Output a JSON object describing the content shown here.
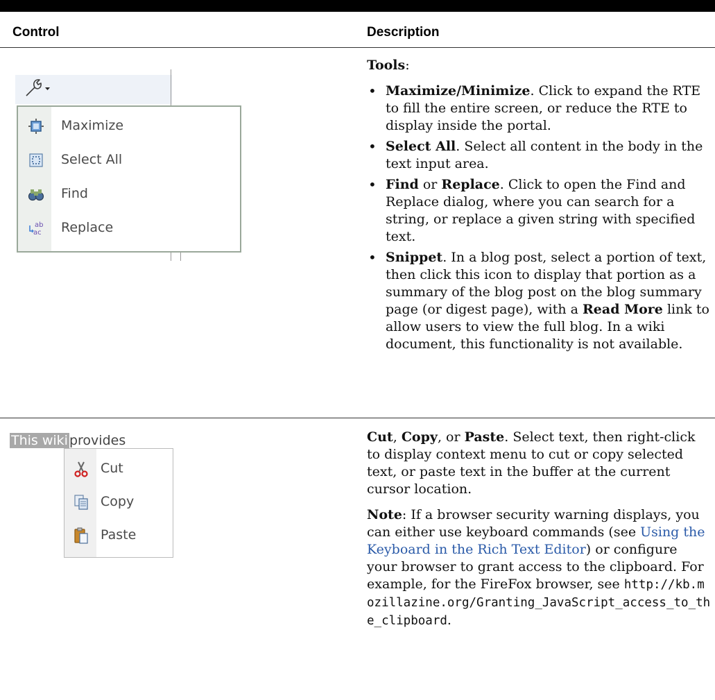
{
  "table": {
    "headers": {
      "control": "Control",
      "description": "Description"
    },
    "row1": {
      "tools_menu": {
        "items": [
          {
            "label": "Maximize",
            "icon": "maximize-icon"
          },
          {
            "label": "Select All",
            "icon": "select-all-icon"
          },
          {
            "label": "Find",
            "icon": "binoculars-icon"
          },
          {
            "label": "Replace",
            "icon": "replace-icon"
          }
        ]
      },
      "title": "Tools",
      "title_suffix": ":",
      "bullets": [
        {
          "bold": "Maximize/Minimize",
          "text": ". Click to expand the RTE to fill the entire screen, or reduce the RTE to display inside the portal."
        },
        {
          "bold": "Select All",
          "text": ". Select all content in the body in the text input area."
        },
        {
          "bold": "Find",
          "mid": " or ",
          "bold2": "Replace",
          "text": ". Click to open the Find and Replace dialog, where you can search for a string, or replace a given string with specified text."
        },
        {
          "bold": "Snippet",
          "text": ". In a blog post, select a portion of text, then click this icon to display that portion as a summary of the blog post on the blog summary page (or digest page), with a ",
          "bold2": "Read More",
          "text2": " link to allow users to view the full blog. In a wiki document, this functionality is not available."
        }
      ]
    },
    "row2": {
      "context_menu": {
        "selected_text": "This wiki",
        "rest_text": "provides",
        "items": [
          {
            "label": "Cut",
            "icon": "scissors-icon"
          },
          {
            "label": "Copy",
            "icon": "copy-icon"
          },
          {
            "label": "Paste",
            "icon": "paste-icon"
          }
        ]
      },
      "p1_b1": "Cut",
      "p1_sep1": ", ",
      "p1_b2": "Copy",
      "p1_sep2": ", or ",
      "p1_b3": "Paste",
      "p1_text": ". Select text, then right-click to display context menu to cut or copy selected text, or paste text in the buffer at the current cursor location.",
      "note_label": "Note",
      "note_text": ": If a browser security warning displays, you can either use keyboard commands (see ",
      "note_link": "Using the Keyboard in the Rich Text Editor",
      "note_text2": ") or configure your browser to grant access to the clipboard. For example, for the FireFox browser, see ",
      "note_url": "http://kb.mozillazine.org/Granting_JavaScript_access_to_the_clipboard",
      "note_end": "."
    }
  },
  "colors": {
    "link": "#2a5aa8",
    "rule": "#333333",
    "menu_border": "#9aa89a"
  }
}
